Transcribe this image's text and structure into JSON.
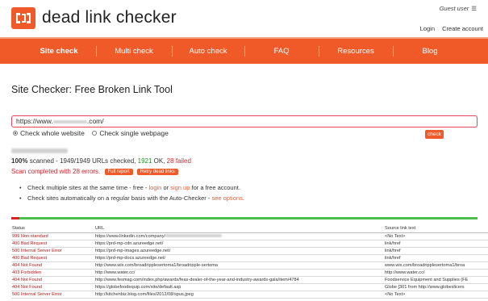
{
  "header": {
    "logo_text": "dead link checker",
    "guest_label": "Guest user",
    "menu_icon": "hamburger-icon",
    "login_label": "Login",
    "create_account_label": "Create account"
  },
  "nav": {
    "items": [
      {
        "label": "Site check",
        "active": true
      },
      {
        "label": "Multi check",
        "active": false
      },
      {
        "label": "Auto check",
        "active": false
      },
      {
        "label": "FAQ",
        "active": false
      },
      {
        "label": "Resources",
        "active": false
      },
      {
        "label": "Blog",
        "active": false
      }
    ]
  },
  "main": {
    "title": "Site Checker: Free Broken Link Tool",
    "url_value": "https://www.",
    "url_value_suffix": ".com/",
    "option_whole": "Check whole website",
    "option_single": "Check single webpage",
    "check_button": "check"
  },
  "results_summary": {
    "scanned_pct": "100%",
    "scanned_label": "scanned -",
    "checked": "1949/1949",
    "checked_label": "URLs checked,",
    "ok_count": "1921",
    "ok_label": "OK,",
    "failed_count": "28",
    "failed_label": "failed",
    "scan_status": "Scan completed with 28 errors.",
    "full_report_button": "Full report",
    "retry_button": "Retry dead links",
    "bad_fraction": 0.014
  },
  "bullets": {
    "b1_prefix": "Check multiple sites at the same time - free -",
    "b1_login": "login",
    "b1_or": "or",
    "b1_signup": "sign up",
    "b1_suffix": "for a free account.",
    "b2_prefix": "Check sites automatically on a regular basis with the Auto-Checker -",
    "b2_link": "see options",
    "b2_suffix": "."
  },
  "table": {
    "headers": [
      "Status",
      "URL",
      "Source link text"
    ],
    "rows": [
      {
        "status": "999 Non-standard",
        "url": "https://www.linkedin.com/company/",
        "source": "<No Text>"
      },
      {
        "status": "400 Bad Request",
        "url": "https://prd-mp-cdn.azureedge.net/",
        "source": "link/href"
      },
      {
        "status": "500 Internal Server Error",
        "url": "https://prd-mp-images.azureedge.net/",
        "source": "link/href"
      },
      {
        "status": "400 Bad Request",
        "url": "https://prd-mp-docs.azureedge.net/",
        "source": "link/href"
      },
      {
        "status": "404 Not Found",
        "url": "http://www.wix.com/broadripplesertoma1/broadripple-sertoma",
        "source": "www.wix.com/broadripplesertoma1/broa"
      },
      {
        "status": "403 Forbidden",
        "url": "http://www.water.cc/",
        "source": "http://www.water.cc/"
      },
      {
        "status": "404 Not Found",
        "url": "http://www.fesmag.com/index.php/awards/feas-dealer-of-the-year-and-industry-awards-gala/item/4784",
        "source": "Foodservice Equipment and Supplies (FE"
      },
      {
        "status": "404 Not Found",
        "url": "https://globefoodequip.com/site/default.asp",
        "source": "Globe [301 from http://www.globeslicers"
      },
      {
        "status": "500 Internal Server Error",
        "url": "http://kitchenbiz.blog.com/files/2012/08/spus.jpeg",
        "source": "<No Text>"
      }
    ]
  }
}
